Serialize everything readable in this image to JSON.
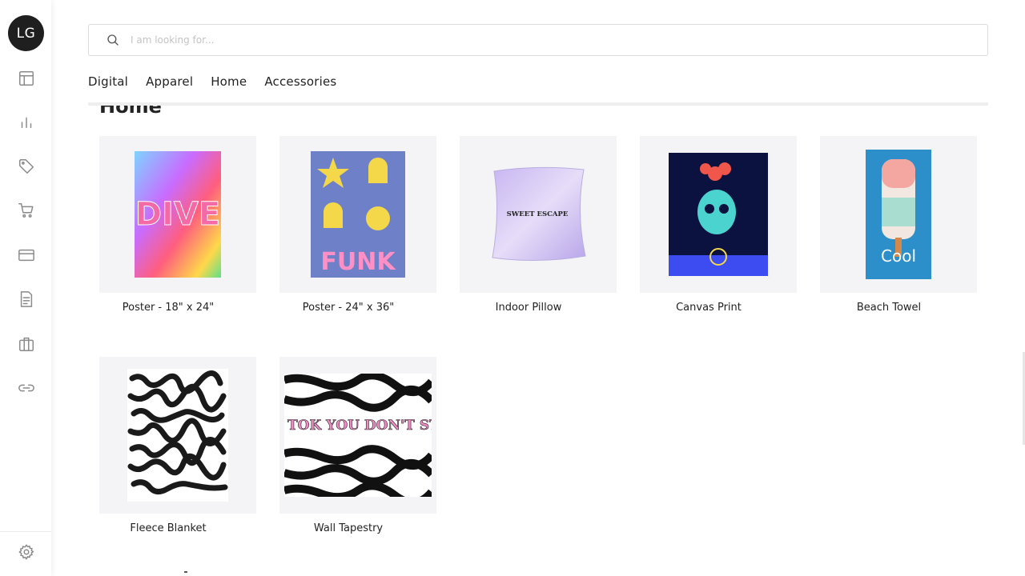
{
  "user": {
    "initials": "LG"
  },
  "sidebar": {
    "items": [
      {
        "icon": "layout-icon"
      },
      {
        "icon": "bar-chart-icon"
      },
      {
        "icon": "tag-icon"
      },
      {
        "icon": "cart-icon"
      },
      {
        "icon": "credit-card-icon"
      },
      {
        "icon": "document-icon"
      },
      {
        "icon": "store-icon"
      },
      {
        "icon": "link-icon"
      }
    ],
    "footer_icon": "gear-icon"
  },
  "search": {
    "placeholder": "I am looking for...",
    "value": ""
  },
  "categories": [
    "Digital",
    "Apparel",
    "Home",
    "Accessories"
  ],
  "section": {
    "title": "Home"
  },
  "products": [
    {
      "name": "Poster - 18\" x 24\"",
      "art_text": "DIVE"
    },
    {
      "name": "Poster - 24\" x 36\"",
      "art_text": "FUNK"
    },
    {
      "name": "Indoor Pillow",
      "art_text": "SWEET ESCAPE"
    },
    {
      "name": "Canvas Print",
      "art_text": ""
    },
    {
      "name": "Beach Towel",
      "art_text": "Cool"
    },
    {
      "name": "Fleece Blanket",
      "art_text": ""
    },
    {
      "name": "Wall Tapestry",
      "art_text": "TIK TOK YOU DON'T STOP"
    }
  ],
  "colors": {
    "accent": "#1f1f1f",
    "thumb_bg": "#f4f4f6",
    "icon_gray": "#8a8a8a"
  }
}
